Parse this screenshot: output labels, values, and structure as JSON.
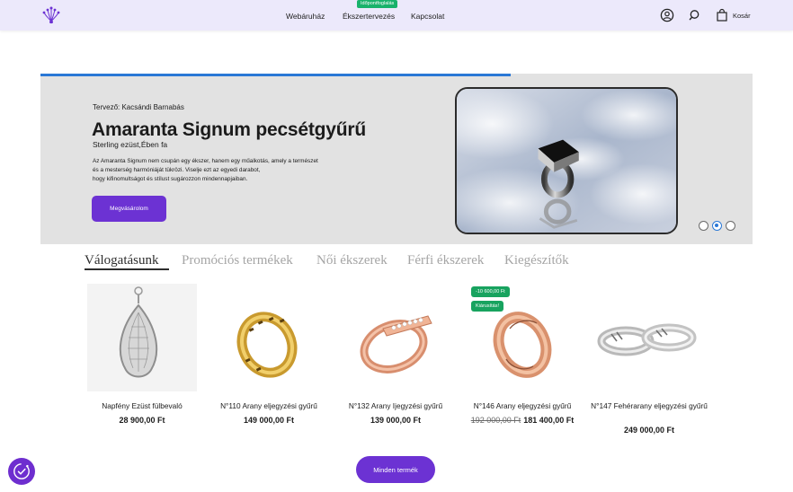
{
  "header": {
    "nav": [
      "Webáruház",
      "Ékszertervezés",
      "Kapcsolat"
    ],
    "nav_badge": "Időpontfoglalás",
    "cart_label": "Kosár",
    "accent": "#6c32d3",
    "bg": "#ece9fb"
  },
  "hero": {
    "designer": "Tervező: Kacsándi Barnabás",
    "title": "Amaranta Signum pecsétgyűrű",
    "subtitle": "Sterling ezüst,Ében fa",
    "description_lines": [
      "Az Amaranta Signum nem csupán egy ékszer, hanem egy műalkotás, amely a természet",
      "és a mesterség harmóniáját tükrözi. Viselje ezt az egyedi darabot,",
      "hogy kifinomultságot és stílust sugározzon mindennapjaiban."
    ],
    "button_label": "Megvásárolom",
    "progress": 0.66,
    "slide_dots": 3,
    "active_dot": 2
  },
  "tabs": [
    {
      "label": "Válogatásunk",
      "active": true
    },
    {
      "label": "Promóciós termékek",
      "active": false
    },
    {
      "label": "Női ékszerek",
      "active": false
    },
    {
      "label": "Férfi ékszerek",
      "active": false
    },
    {
      "label": "Kiegészítők",
      "active": false
    }
  ],
  "products": [
    {
      "name": "Napfény Ezüst fülbevaló",
      "price": "28 900,00 Ft",
      "old_price": "",
      "icon": "earring-silver"
    },
    {
      "name": "N°110 Arany eljegyzési gyűrű",
      "price": "149 000,00 Ft",
      "old_price": "",
      "icon": "ring-gold"
    },
    {
      "name": "N°132 Arany Ijegyzési gyűrű",
      "price": "139 000,00 Ft",
      "old_price": "",
      "icon": "ring-rosegold-diamonds"
    },
    {
      "name": "N°146 Arany eljegyzési gyűrű",
      "price": "181 400,00 Ft",
      "old_price": "192 000,00 Ft",
      "badges": [
        "-10 600,00 Ft",
        "Kiárusítás!"
      ],
      "icon": "ring-rosegold-engraved"
    },
    {
      "name": "N°147 Fehérarany eljegyzési gyűrű",
      "price": "249 000,00 Ft",
      "old_price": "",
      "icon": "ring-pair-white"
    }
  ],
  "all_products_label": "Minden termék",
  "cookie_icon": "cookie-settings-icon"
}
